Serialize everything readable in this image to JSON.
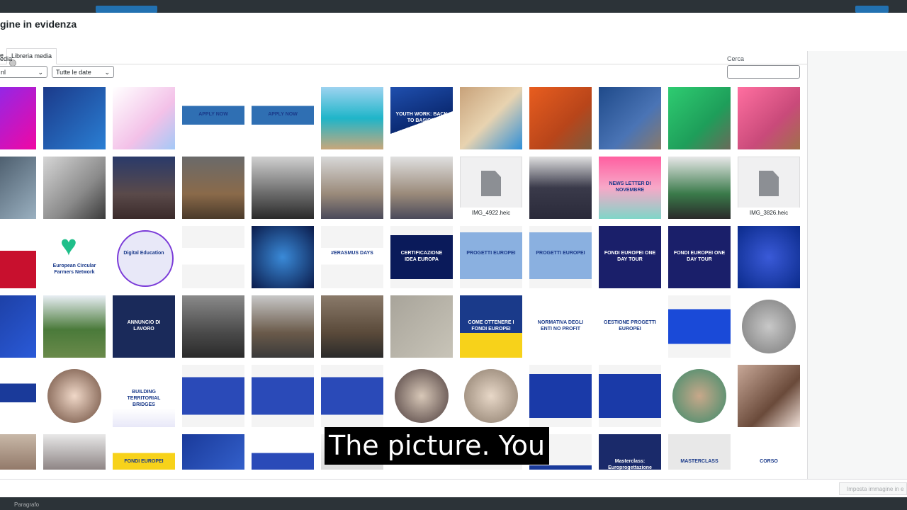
{
  "modal": {
    "title": "gine in evidenza",
    "tab_upload_label": "e",
    "tab_library_label": "Libreria media",
    "filter_label": "edia",
    "type_filter_value": "nl",
    "date_filter_value": "Tutte le date",
    "search_label": "Cerca",
    "search_value": "",
    "set_button_label": "Imposta immagine in e",
    "bottom_label": "Paragrafo"
  },
  "subtitle": "The picture. You",
  "colors": {
    "accent": "#2271b1",
    "background_dark": "#1d2327"
  },
  "media_items": [
    {
      "row": 0,
      "col": 0,
      "kind": "image",
      "bg": "linear-gradient(135deg,#7b2ff7,#f107a3)",
      "text": ""
    },
    {
      "row": 0,
      "col": 1,
      "kind": "image",
      "bg": "linear-gradient(135deg,#1b3a8a,#2a7fd4)",
      "text": ""
    },
    {
      "row": 0,
      "col": 2,
      "kind": "image",
      "bg": "linear-gradient(135deg,#ffffff,#f3c1e8 60%,#a3c9f7)",
      "text": ""
    },
    {
      "row": 0,
      "col": 3,
      "kind": "image",
      "bg": "linear-gradient(180deg,#ffffff 30%,#2f6fb3 30%,#2f6fb3 60%,#ffffff 60%)",
      "text": "APPLY NOW"
    },
    {
      "row": 0,
      "col": 4,
      "kind": "image",
      "bg": "linear-gradient(180deg,#ffffff 30%,#2f6fb3 30%,#2f6fb3 60%,#ffffff 60%)",
      "text": "APPLY NOW"
    },
    {
      "row": 0,
      "col": 5,
      "kind": "image",
      "bg": "linear-gradient(180deg,#9dd3f0,#1fb5c9 50%,#c9a77a)",
      "text": ""
    },
    {
      "row": 0,
      "col": 6,
      "kind": "image",
      "bg": "linear-gradient(160deg,#1f4fae,#0b2a73 55%,#ffffff 55%)",
      "text": "YOUTH WORK: BACK TO BASICS!"
    },
    {
      "row": 0,
      "col": 7,
      "kind": "image",
      "bg": "linear-gradient(135deg,#c8a27a,#e8d3b0 50%,#2f8fd8)",
      "text": ""
    },
    {
      "row": 0,
      "col": 8,
      "kind": "image",
      "bg": "linear-gradient(135deg,#e85d1f,#b8451a 60%,#7a5c40)",
      "text": ""
    },
    {
      "row": 0,
      "col": 9,
      "kind": "image",
      "bg": "linear-gradient(135deg,#1f4a8a,#4a74b5 60%,#8a7a6a)",
      "text": ""
    },
    {
      "row": 0,
      "col": 10,
      "kind": "image",
      "bg": "linear-gradient(135deg,#2ecc71,#1e9e5a 60%,#6a6a5a)",
      "text": ""
    },
    {
      "row": 0,
      "col": 11,
      "kind": "image",
      "bg": "linear-gradient(135deg,#ff6fa0,#c94a7a 60%,#a0704a)",
      "text": ""
    },
    {
      "row": 1,
      "col": 0,
      "kind": "image",
      "bg": "linear-gradient(135deg,#3a4a5a,#9ab0c0)",
      "text": ""
    },
    {
      "row": 1,
      "col": 1,
      "kind": "image",
      "bg": "linear-gradient(135deg,#d6d6d6,#8a8a8a 60%,#3a3a3a)",
      "text": ""
    },
    {
      "row": 1,
      "col": 2,
      "kind": "image",
      "bg": "linear-gradient(180deg,#2a3a6a,#5a4a4a 60%,#3a2a2a)",
      "text": ""
    },
    {
      "row": 1,
      "col": 3,
      "kind": "image",
      "bg": "linear-gradient(180deg,#6a6a6a,#8a6a4a 60%,#4a3a2a)",
      "text": ""
    },
    {
      "row": 1,
      "col": 4,
      "kind": "image",
      "bg": "linear-gradient(180deg,#d0d0d0,#6a6a6a 60%,#2a2a2a)",
      "text": ""
    },
    {
      "row": 1,
      "col": 5,
      "kind": "image",
      "bg": "linear-gradient(180deg,#d8d8d8,#9a8a7a 60%,#4a4a5a)",
      "text": ""
    },
    {
      "row": 1,
      "col": 6,
      "kind": "image",
      "bg": "linear-gradient(180deg,#e0e0e0,#9a8a7a 60%,#4a4a5a)",
      "text": ""
    },
    {
      "row": 1,
      "col": 7,
      "kind": "file",
      "bg": "#f0f0f1",
      "caption": "IMG_4922.heic"
    },
    {
      "row": 1,
      "col": 8,
      "kind": "image",
      "bg": "linear-gradient(180deg,#e0e0e0,#3a3a4a 50%,#2a2a3a)",
      "text": ""
    },
    {
      "row": 1,
      "col": 9,
      "kind": "image",
      "bg": "linear-gradient(180deg,#ff5fa0,#f7a8c8 50%,#7fd6c8)",
      "text": "NEWS LETTER DI NOVEMBRE"
    },
    {
      "row": 1,
      "col": 10,
      "kind": "image",
      "bg": "linear-gradient(180deg,#e8e8e8,#3a7a4a 60%,#2a2a2a)",
      "text": ""
    },
    {
      "row": 1,
      "col": 11,
      "kind": "file",
      "bg": "#f0f0f1",
      "caption": "IMG_3826.heic"
    },
    {
      "row": 2,
      "col": 0,
      "kind": "image",
      "bg": "linear-gradient(180deg,#ffffff 40%,#c8102e 40%)",
      "text": ""
    },
    {
      "row": 2,
      "col": 1,
      "kind": "heart",
      "bg": "#ffffff",
      "text": "European Circular Farmers Network"
    },
    {
      "row": 2,
      "col": 2,
      "kind": "circle",
      "bg": "#ffffff",
      "text": "Digital Education"
    },
    {
      "row": 2,
      "col": 3,
      "kind": "image",
      "bg": "linear-gradient(180deg,#f4f4f4 35%,#ffffff 35%,#ffffff 62%,#f4f4f4 62%)",
      "text": ""
    },
    {
      "row": 2,
      "col": 4,
      "kind": "image",
      "bg": "radial-gradient(circle,#3a8ad8,#0a1a4a)",
      "text": ""
    },
    {
      "row": 2,
      "col": 5,
      "kind": "image",
      "bg": "linear-gradient(180deg,#f4f4f4 35%,#ffffff 35%,#ffffff 62%,#f4f4f4 62%)",
      "text": "#ERASMUS DAYS"
    },
    {
      "row": 2,
      "col": 6,
      "kind": "image",
      "bg": "linear-gradient(180deg,#f4f4f4 15%,#0a1a5a 15%,#0a1a5a 85%,#f4f4f4 85%)",
      "text": "CERTIFICAZIONE IDEA EUROPA"
    },
    {
      "row": 2,
      "col": 7,
      "kind": "image",
      "bg": "linear-gradient(180deg,#f4f4f4 10%,#8ab0e0 10%,#8ab0e0 85%,#f4f4f4 85%)",
      "text": "PROGETTI EUROPEI"
    },
    {
      "row": 2,
      "col": 8,
      "kind": "image",
      "bg": "linear-gradient(180deg,#f4f4f4 10%,#8ab0e0 10%,#8ab0e0 85%,#f4f4f4 85%)",
      "text": "PROGETTI EUROPEI"
    },
    {
      "row": 2,
      "col": 9,
      "kind": "image",
      "bg": "#1a1f6a",
      "text": "FONDI EUROPEI ONE DAY TOUR"
    },
    {
      "row": 2,
      "col": 10,
      "kind": "image",
      "bg": "#1a1f6a",
      "text": "FONDI EUROPEI ONE DAY TOUR"
    },
    {
      "row": 2,
      "col": 11,
      "kind": "image",
      "bg": "radial-gradient(circle,#3a5ad8,#0a2a8a)",
      "text": ""
    },
    {
      "row": 3,
      "col": 0,
      "kind": "image",
      "bg": "linear-gradient(135deg,#1a3a9a,#2a5ad8)",
      "text": ""
    },
    {
      "row": 3,
      "col": 1,
      "kind": "image",
      "bg": "linear-gradient(180deg,#e8eef4,#4a7a3a 55%,#6a8a4a)",
      "text": ""
    },
    {
      "row": 3,
      "col": 2,
      "kind": "image",
      "bg": "#1a2a5a",
      "text": "ANNUNCIO DI LAVORO"
    },
    {
      "row": 3,
      "col": 3,
      "kind": "image",
      "bg": "linear-gradient(180deg,#8a8a8a,#4a4a4a 60%,#2a2a2a)",
      "text": ""
    },
    {
      "row": 3,
      "col": 4,
      "kind": "image",
      "bg": "linear-gradient(180deg,#c8c8c8,#6a5a4a 60%,#3a3a3a)",
      "text": ""
    },
    {
      "row": 3,
      "col": 5,
      "kind": "image",
      "bg": "linear-gradient(180deg,#8a7a6a,#5a4a3a 60%,#2a2a2a)",
      "text": ""
    },
    {
      "row": 3,
      "col": 6,
      "kind": "image",
      "bg": "linear-gradient(135deg,#a8a49a,#c8c4b8)",
      "text": ""
    },
    {
      "row": 3,
      "col": 7,
      "kind": "image",
      "bg": "linear-gradient(180deg,#1a3a8a 60%,#f7d21a 60%)",
      "text": "COME OTTENERE I FONDI EUROPEI"
    },
    {
      "row": 3,
      "col": 8,
      "kind": "image",
      "bg": "#ffffff",
      "text": "NORMATIVA DEGLI ENTI NO PROFIT"
    },
    {
      "row": 3,
      "col": 9,
      "kind": "image",
      "bg": "#ffffff",
      "text": "GESTIONE PROGETTI EUROPEI"
    },
    {
      "row": 3,
      "col": 10,
      "kind": "image",
      "bg": "linear-gradient(180deg,#f4f4f4 22%,#1a4ad8 22%,#1a4ad8 78%,#f4f4f4 78%)",
      "text": ""
    },
    {
      "row": 3,
      "col": 11,
      "kind": "circle",
      "bg": "radial-gradient(circle,#c8c8c8,#7a7a7a)",
      "text": ""
    },
    {
      "row": 4,
      "col": 0,
      "kind": "image",
      "bg": "linear-gradient(180deg,#ffffff 30%,#1a3a9a 30%,#1a3a9a 60%,#ffffff 60%)",
      "text": ""
    },
    {
      "row": 4,
      "col": 1,
      "kind": "circle",
      "bg": "radial-gradient(circle,#f0d8c8,#6a4a3a)",
      "text": ""
    },
    {
      "row": 4,
      "col": 2,
      "kind": "image",
      "bg": "linear-gradient(180deg,#ffffff 30%,#ffffff 70%,#e8e8f8)",
      "text": "BUILDING TERRITORIAL BRIDGES"
    },
    {
      "row": 4,
      "col": 3,
      "kind": "image",
      "bg": "linear-gradient(180deg,#f4f4f4 20%,#2a4ab8 20%,#2a4ab8 80%,#f4f4f4 80%)",
      "text": ""
    },
    {
      "row": 4,
      "col": 4,
      "kind": "image",
      "bg": "linear-gradient(180deg,#f4f4f4 20%,#2a4ab8 20%,#2a4ab8 80%,#f4f4f4 80%)",
      "text": ""
    },
    {
      "row": 4,
      "col": 5,
      "kind": "image",
      "bg": "linear-gradient(180deg,#f4f4f4 20%,#2a4ab8 20%,#2a4ab8 80%,#f4f4f4 80%)",
      "text": ""
    },
    {
      "row": 4,
      "col": 6,
      "kind": "circle",
      "bg": "radial-gradient(circle,#d8c8b8,#4a3a3a)",
      "text": ""
    },
    {
      "row": 4,
      "col": 7,
      "kind": "circle",
      "bg": "radial-gradient(circle,#e8d8c8,#8a7a6a)",
      "text": ""
    },
    {
      "row": 4,
      "col": 8,
      "kind": "image",
      "bg": "linear-gradient(180deg,#f4f4f4 15%,#1a3aa8 15%,#1a3aa8 85%,#f4f4f4 85%)",
      "text": ""
    },
    {
      "row": 4,
      "col": 9,
      "kind": "image",
      "bg": "linear-gradient(180deg,#f4f4f4 15%,#1a3aa8 15%,#1a3aa8 85%,#f4f4f4 85%)",
      "text": ""
    },
    {
      "row": 4,
      "col": 10,
      "kind": "circle",
      "bg": "radial-gradient(circle,#c8a88a,#3a8a6a)",
      "text": ""
    },
    {
      "row": 4,
      "col": 11,
      "kind": "image",
      "bg": "linear-gradient(135deg,#c8a898,#6a4a3a 60%,#f0e0d8)",
      "text": ""
    },
    {
      "row": 5,
      "col": 0,
      "kind": "image",
      "bg": "linear-gradient(180deg,#c8b8a8,#6a4a3a)",
      "text": ""
    },
    {
      "row": 5,
      "col": 1,
      "kind": "image",
      "bg": "linear-gradient(180deg,#e8e8e8,#4a3a3a)",
      "text": ""
    },
    {
      "row": 5,
      "col": 2,
      "kind": "image",
      "bg": "linear-gradient(180deg,#ffffff 30%,#f7d21a 30%)",
      "text": "FONDI EUROPEI"
    },
    {
      "row": 5,
      "col": 3,
      "kind": "image",
      "bg": "linear-gradient(135deg,#1a3a9a,#3a6ad8)",
      "text": ""
    },
    {
      "row": 5,
      "col": 4,
      "kind": "image",
      "bg": "linear-gradient(180deg,#ffffff 30%,#2a4ab8 30%)",
      "text": ""
    },
    {
      "row": 5,
      "col": 5,
      "kind": "image",
      "bg": "linear-gradient(180deg,#f4f4f4,#c8c8c8)",
      "text": ""
    },
    {
      "row": 5,
      "col": 6,
      "kind": "image",
      "bg": "#ffffff",
      "text": ""
    },
    {
      "row": 5,
      "col": 7,
      "kind": "image",
      "bg": "#f4f4f4",
      "text": ""
    },
    {
      "row": 5,
      "col": 8,
      "kind": "image",
      "bg": "linear-gradient(180deg,#f4f4f4 50%,#1a3a9a 50%)",
      "text": ""
    },
    {
      "row": 5,
      "col": 9,
      "kind": "image",
      "bg": "#1a2a6a",
      "text": "Masterclass: Europrogettazione"
    },
    {
      "row": 5,
      "col": 10,
      "kind": "image",
      "bg": "#e8e8e8",
      "text": "MASTERCLASS"
    },
    {
      "row": 5,
      "col": 11,
      "kind": "image",
      "bg": "#ffffff",
      "text": "CORSO"
    }
  ]
}
